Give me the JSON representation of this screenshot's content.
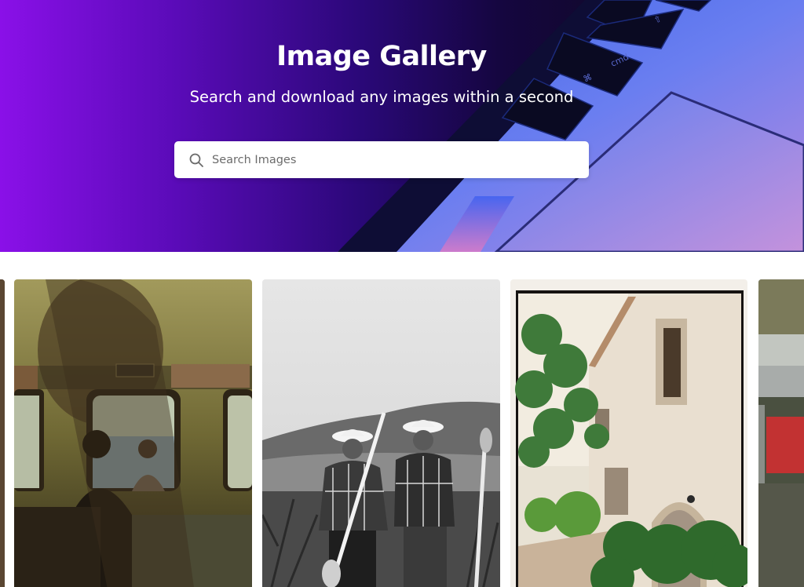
{
  "hero": {
    "title": "Image Gallery",
    "subtitle": "Search and download any images within a second",
    "accent_colors": [
      "#8a10e8",
      "#2a0878",
      "#12082e"
    ]
  },
  "search": {
    "placeholder": "Search Images",
    "value": "",
    "icon": "search-icon"
  },
  "gallery": {
    "images": [
      {
        "name": "image-card-partial-left"
      },
      {
        "name": "image-card-train-window"
      },
      {
        "name": "image-card-two-farmers"
      },
      {
        "name": "image-card-stone-house"
      },
      {
        "name": "image-card-partial-right"
      }
    ]
  }
}
